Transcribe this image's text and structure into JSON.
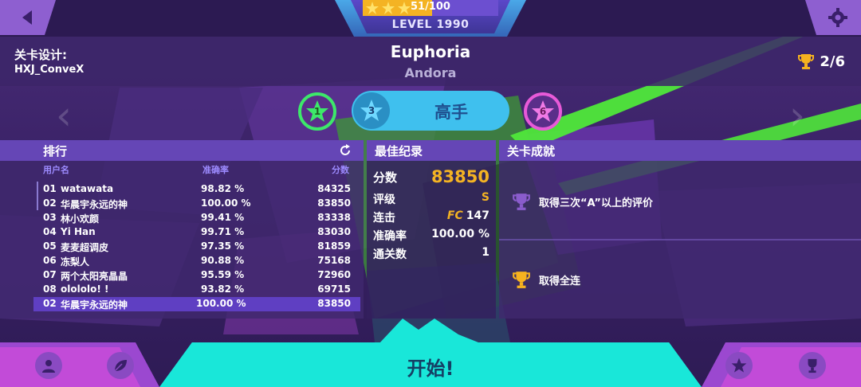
{
  "level": {
    "progress_text": "51/100",
    "progress_fraction": 0.51,
    "level_label": "LEVEL 1990"
  },
  "designer": {
    "label": "关卡设计:",
    "name": "HXJ_ConveX"
  },
  "song": {
    "title": "Euphoria",
    "artist": "Andora"
  },
  "trophies": {
    "count": "2/6"
  },
  "difficulty": {
    "left_number": "1",
    "selected_number": "3",
    "selected_label": "高手",
    "right_number": "6",
    "colors": {
      "easy": "#3de86a",
      "selected": "#3fc0ee",
      "hard": "#e85ad8"
    }
  },
  "ranking": {
    "title": "排行",
    "col_user": "用户名",
    "col_accuracy": "准确率",
    "col_score": "分数",
    "rows": [
      {
        "rank": "01",
        "name": "watawata",
        "accuracy": "98.82 %",
        "score": "84325"
      },
      {
        "rank": "02",
        "name": "华晨宇永远的神",
        "accuracy": "100.00 %",
        "score": "83850"
      },
      {
        "rank": "03",
        "name": "林小欢颜",
        "accuracy": "99.41 %",
        "score": "83338"
      },
      {
        "rank": "04",
        "name": "Yi Han",
        "accuracy": "99.71 %",
        "score": "83030"
      },
      {
        "rank": "05",
        "name": "麦麦超调皮",
        "accuracy": "97.35 %",
        "score": "81859"
      },
      {
        "rank": "06",
        "name": "冻梨人",
        "accuracy": "90.88 %",
        "score": "75168"
      },
      {
        "rank": "07",
        "name": "两个太阳亮晶晶",
        "accuracy": "95.59 %",
        "score": "72960"
      },
      {
        "rank": "08",
        "name": "olololo! !",
        "accuracy": "93.82 %",
        "score": "69715"
      }
    ],
    "current": {
      "rank": "02",
      "name": "华晨宇永远的神",
      "accuracy": "100.00 %",
      "score": "83850"
    }
  },
  "best": {
    "title": "最佳纪录",
    "score_label": "分数",
    "score_value": "83850",
    "grade_label": "评级",
    "grade_value": "S",
    "combo_label": "连击",
    "combo_badge": "FC",
    "combo_value": "147",
    "accuracy_label": "准确率",
    "accuracy_value": "100.00 %",
    "clears_label": "通关数",
    "clears_value": "1"
  },
  "achievements": {
    "title": "关卡成就",
    "items": [
      {
        "label": "取得三次“A”以上的评价",
        "icon": "trophy-icon",
        "color": "#8a5ccc"
      },
      {
        "label": "取得全连",
        "icon": "trophy-icon",
        "color": "#f6b21f"
      }
    ]
  },
  "bottom": {
    "start_label": "开始!"
  },
  "colors": {
    "accent_gold": "#f4b323",
    "cyan": "#19e7d9",
    "panel_head": "#6546b6",
    "green": "#4fe83a"
  }
}
